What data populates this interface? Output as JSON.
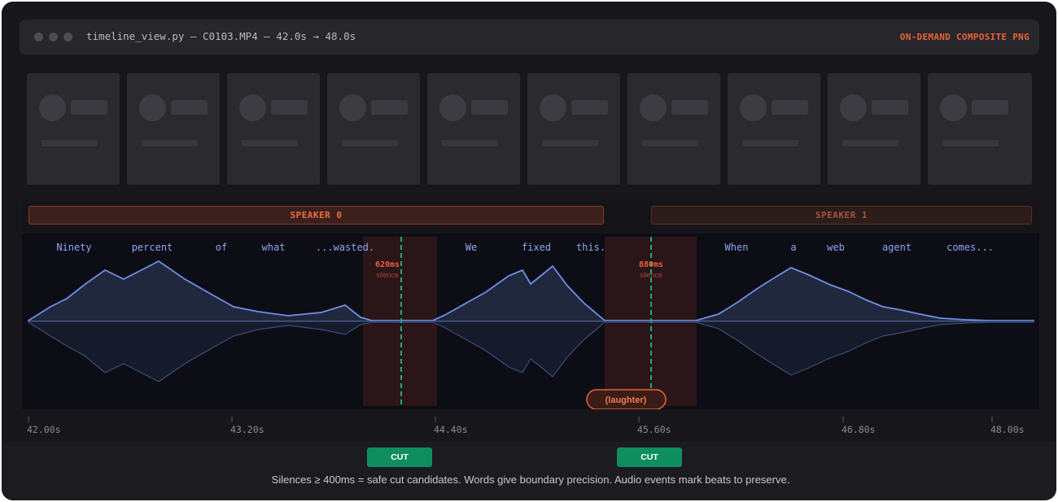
{
  "window": {
    "title": "timeline_view.py — C0103.MP4 — 42.0s → 48.0s",
    "badge": "ON-DEMAND COMPOSITE PNG"
  },
  "thumbnail_count": 10,
  "speakers": [
    {
      "label": "SPEAKER 0"
    },
    {
      "label": "SPEAKER 1"
    }
  ],
  "words": [
    "Ninety",
    "percent",
    "of",
    "what",
    "...wasted.",
    "We",
    "fixed",
    "this.",
    "When",
    "a",
    "web",
    "agent",
    "comes..."
  ],
  "silences": [
    {
      "duration": "620ms",
      "label": "silence"
    },
    {
      "duration": "880ms",
      "label": "silence"
    }
  ],
  "audio_event": "(laughter)",
  "ruler": {
    "ticks": [
      "42.00s",
      "43.20s",
      "44.40s",
      "45.60s",
      "46.80s",
      "48.00s"
    ]
  },
  "cuts": [
    {
      "label": "CUT"
    },
    {
      "label": "CUT"
    }
  ],
  "caption": "Silences ≥ 400ms = safe cut candidates. Words give boundary precision. Audio events mark beats to preserve.",
  "colors": {
    "accent": "#e8623a",
    "waveform": "#6f8fe8",
    "cut": "#0e8e5f",
    "cut_line": "#16b07a",
    "silence_fill": "#2a1518",
    "word": "#8fa6f0"
  }
}
